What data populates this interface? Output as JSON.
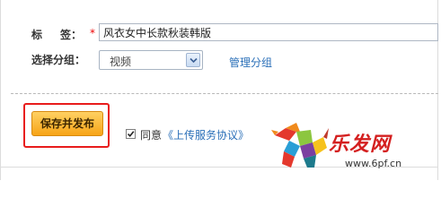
{
  "form": {
    "tag_label_a": "标",
    "tag_label_b": "签：",
    "required_mark": "*",
    "tag_value": "风衣女中长款秋装韩版",
    "group_label": "选择分组：",
    "group_selected": "视频",
    "manage_group_link": "管理分组"
  },
  "actions": {
    "publish_button": "保存并发布",
    "agree_prefix": "同意",
    "agreement_link": "《上传服务协议》",
    "agree_checked": true
  },
  "watermark": {
    "brand_name": "乐发网",
    "url": "www.6pf.cn"
  },
  "colors": {
    "link": "#2a6fb8",
    "highlight_border": "#e81c1c",
    "button_fill": "#f7a417"
  }
}
